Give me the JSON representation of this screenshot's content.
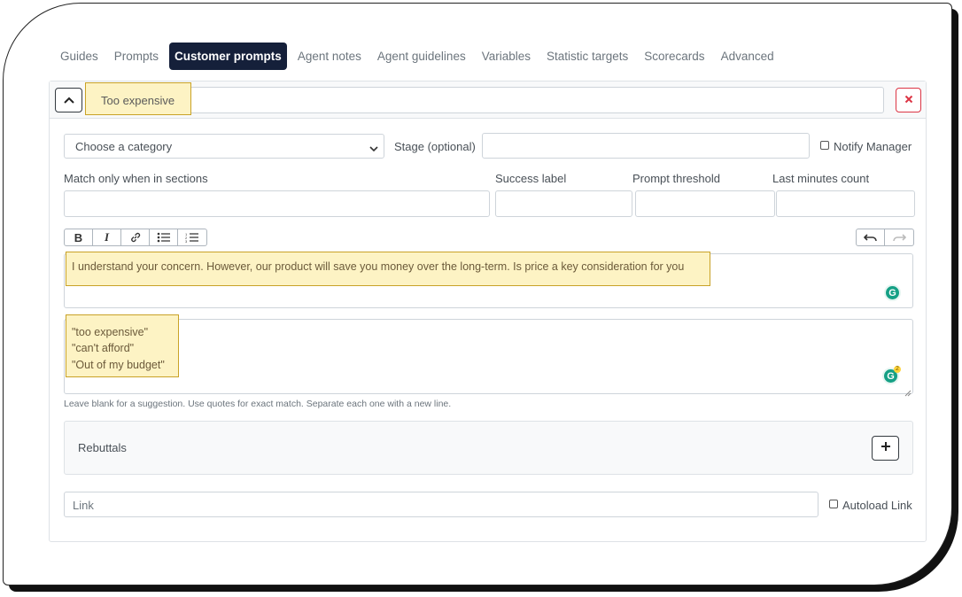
{
  "tabs": [
    {
      "label": "Guides",
      "active": false
    },
    {
      "label": "Prompts",
      "active": false
    },
    {
      "label": "Customer prompts",
      "active": true
    },
    {
      "label": "Agent notes",
      "active": false
    },
    {
      "label": "Agent guidelines",
      "active": false
    },
    {
      "label": "Variables",
      "active": false
    },
    {
      "label": "Statistic targets",
      "active": false
    },
    {
      "label": "Scorecards",
      "active": false
    },
    {
      "label": "Advanced",
      "active": false
    }
  ],
  "prompt": {
    "name_value": "Too expensive",
    "collapse_icon": "chevron-up-icon",
    "delete_icon": "close-icon"
  },
  "form": {
    "category_select": "Choose a category",
    "stage_label": "Stage (optional)",
    "stage_value": "",
    "notify_manager_label": "Notify Manager",
    "notify_manager_checked": false,
    "sections_label": "Match only when in sections",
    "success_label": "Success label",
    "prompt_threshold_label": "Prompt threshold",
    "last_minutes_label": "Last minutes count"
  },
  "editor": {
    "toolbar": [
      {
        "icon": "bold-icon",
        "glyph": "B"
      },
      {
        "icon": "italic-icon",
        "glyph": "I"
      },
      {
        "icon": "link-icon",
        "glyph": ""
      },
      {
        "icon": "bullet-list-icon",
        "glyph": ""
      },
      {
        "icon": "numbered-list-icon",
        "glyph": ""
      }
    ],
    "undo_icon": "undo-icon",
    "redo_icon": "redo-icon",
    "response_text": "I understand your concern. However, our product will save you money over the long-term. Is price a key consideration for you",
    "grammarly_icon": "grammarly-icon",
    "grammarly_glyph": "G",
    "grammarly_count": "2"
  },
  "triggers": {
    "lines": [
      "\"too expensive\"",
      "\"can't afford\"",
      "\"Out of my budget\""
    ],
    "hint": "Leave blank for a suggestion. Use quotes for exact match. Separate each one with a new line."
  },
  "rebuttals": {
    "label": "Rebuttals",
    "add_icon": "plus-icon"
  },
  "link": {
    "placeholder": "Link",
    "autoload_label": "Autoload Link",
    "autoload_checked": false
  },
  "colors": {
    "active_tab_bg": "#15203a",
    "highlight_bg": "#fdf3c4",
    "highlight_border": "#c9a227",
    "delete_red": "#dc3545",
    "grammarly_green": "#15a085"
  }
}
